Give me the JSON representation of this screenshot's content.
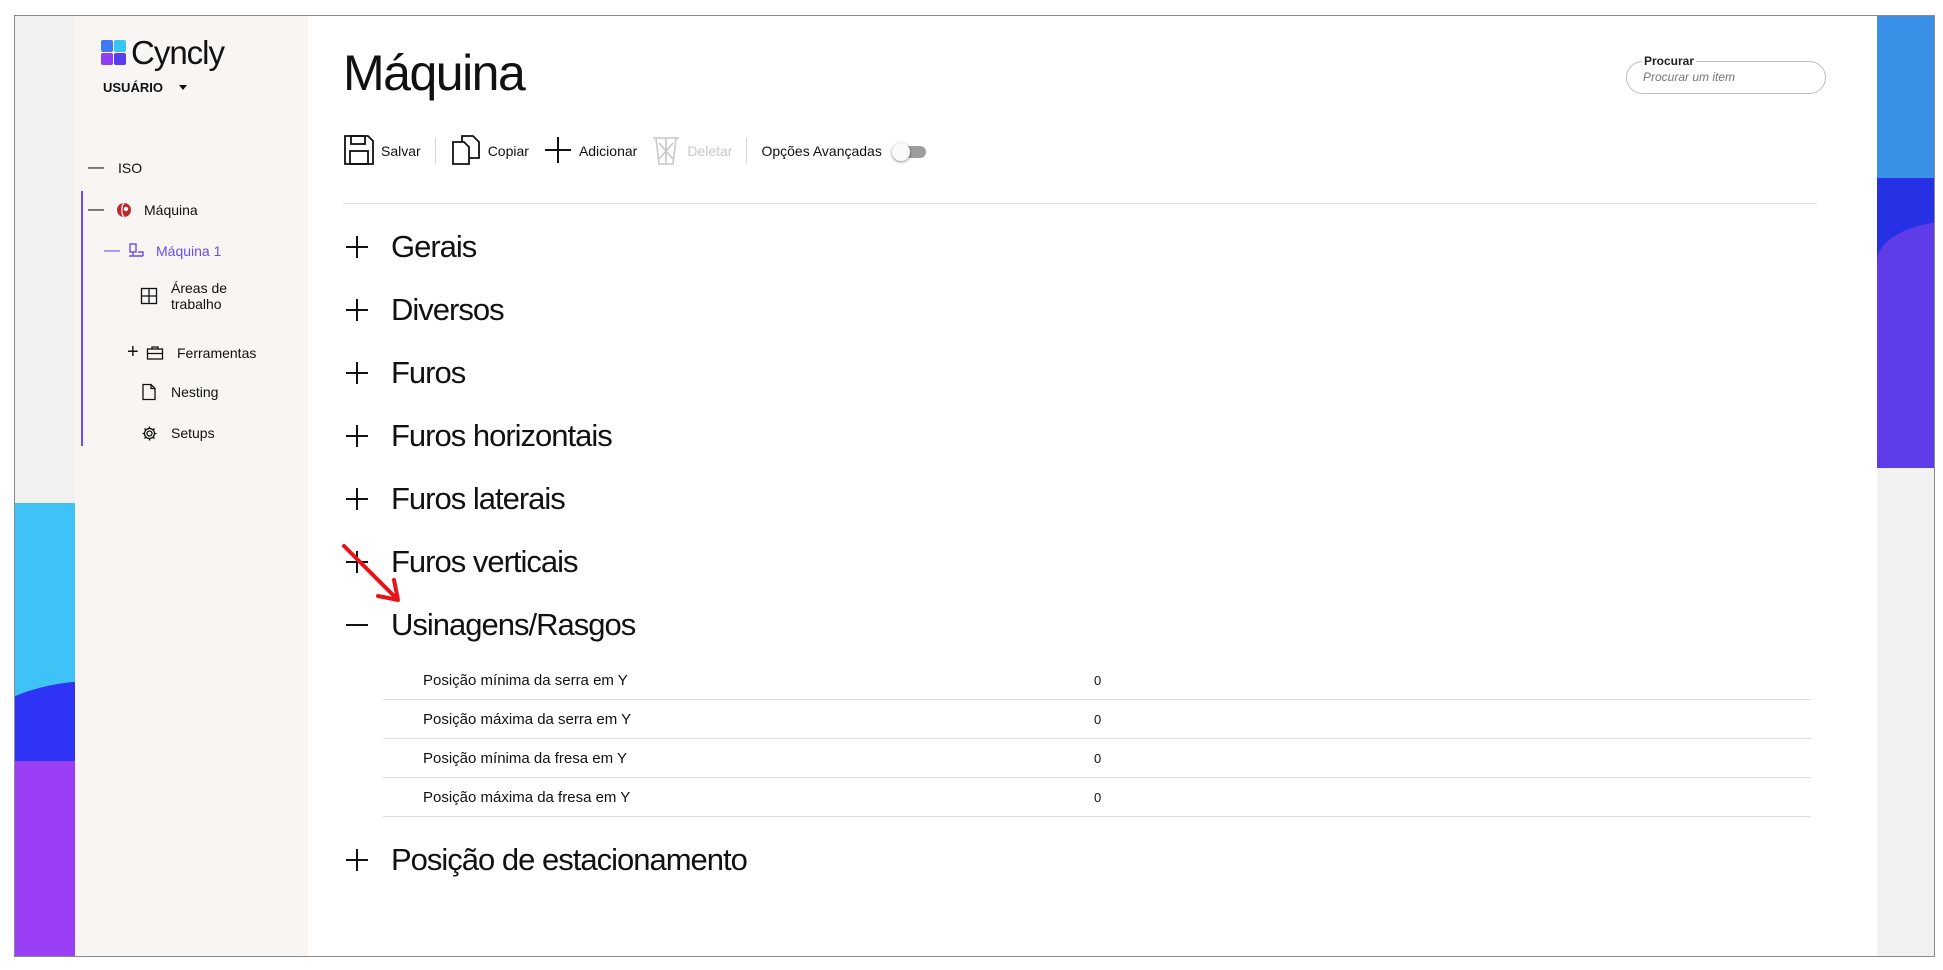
{
  "app": {
    "logo_text": "Cyncly",
    "user_label": "USUÁRIO"
  },
  "sidebar": {
    "items": [
      {
        "label": "ISO",
        "expander": "—",
        "icon": "none"
      },
      {
        "label": "Máquina",
        "expander": "—",
        "icon": "machine-globe-icon"
      },
      {
        "label": "Máquina 1",
        "expander": "—",
        "icon": "machine-tool-icon"
      },
      {
        "label": "Áreas de trabalho",
        "expander": "",
        "icon": "grid-icon"
      },
      {
        "label": "Ferramentas",
        "expander": "+",
        "icon": "briefcase-icon"
      },
      {
        "label": "Nesting",
        "expander": "",
        "icon": "document-icon"
      },
      {
        "label": "Setups",
        "expander": "",
        "icon": "gear-icon"
      }
    ],
    "active_color": "#6a4df0"
  },
  "header": {
    "title": "Máquina"
  },
  "search": {
    "label": "Procurar",
    "placeholder": "Procurar um item"
  },
  "toolbar": {
    "save": "Salvar",
    "copy": "Copiar",
    "add": "Adicionar",
    "delete": "Deletar",
    "advanced": "Opções Avançadas",
    "advanced_enabled": false
  },
  "sections": [
    {
      "label": "Gerais",
      "expanded": false
    },
    {
      "label": "Diversos",
      "expanded": false
    },
    {
      "label": "Furos",
      "expanded": false
    },
    {
      "label": "Furos horizontais",
      "expanded": false
    },
    {
      "label": "Furos laterais",
      "expanded": false
    },
    {
      "label": "Furos verticais",
      "expanded": false
    },
    {
      "label": "Usinagens/Rasgos",
      "expanded": true
    },
    {
      "label": "Posição de estacionamento",
      "expanded": false
    }
  ],
  "properties": [
    {
      "name": "Posição mínima da serra em Y",
      "value": "0"
    },
    {
      "name": "Posição máxima da serra em Y",
      "value": "0"
    },
    {
      "name": "Posição mínima da fresa em Y",
      "value": "0"
    },
    {
      "name": "Posição máxima da fresa em Y",
      "value": "0"
    }
  ],
  "colors": {
    "annotation_arrow": "#e8141b",
    "accent": "#6a4df0"
  }
}
